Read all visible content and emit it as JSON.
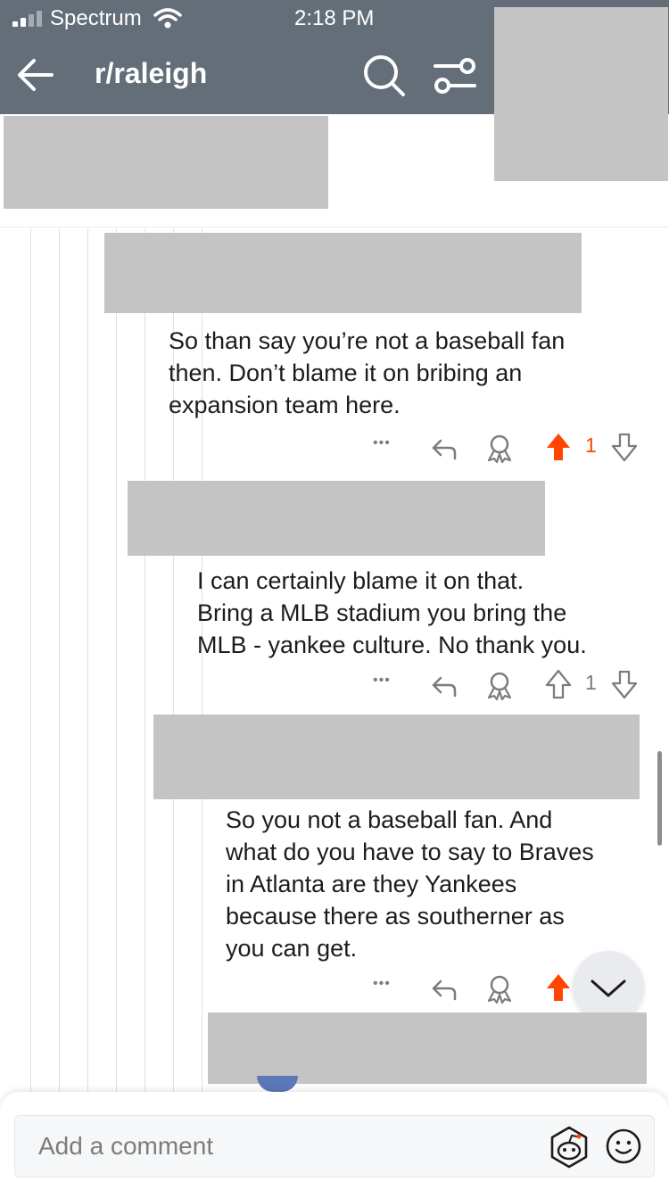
{
  "status_bar": {
    "carrier": "Spectrum",
    "time": "2:18 PM"
  },
  "header": {
    "title": "r/raleigh",
    "back_icon": "arrow-left-icon",
    "search_icon": "search-icon",
    "filter_icon": "sort-filter-icon"
  },
  "colors": {
    "header_bg": "#646e78",
    "upvote_active": "#ff4500",
    "redaction": "#c4c4c4"
  },
  "comments": [
    {
      "text": [
        "So than say you’re not a baseball fan",
        "then. Don’t blame it on bribing an",
        "expansion team here."
      ],
      "score": "1",
      "upvoted": true
    },
    {
      "text": [
        "I can certainly blame it on that.",
        "Bring a MLB stadium you bring the",
        "MLB - yankee culture. No thank you."
      ],
      "score": "1",
      "upvoted": false
    },
    {
      "text": [
        "So you not a baseball fan. And",
        "what do you have to say to Braves",
        "in Atlanta are they Yankees",
        "because there as southerner as",
        "you can get."
      ],
      "score": "",
      "upvoted": true
    }
  ],
  "actions": {
    "more": "•••"
  },
  "composer": {
    "placeholder": "Add a comment"
  }
}
